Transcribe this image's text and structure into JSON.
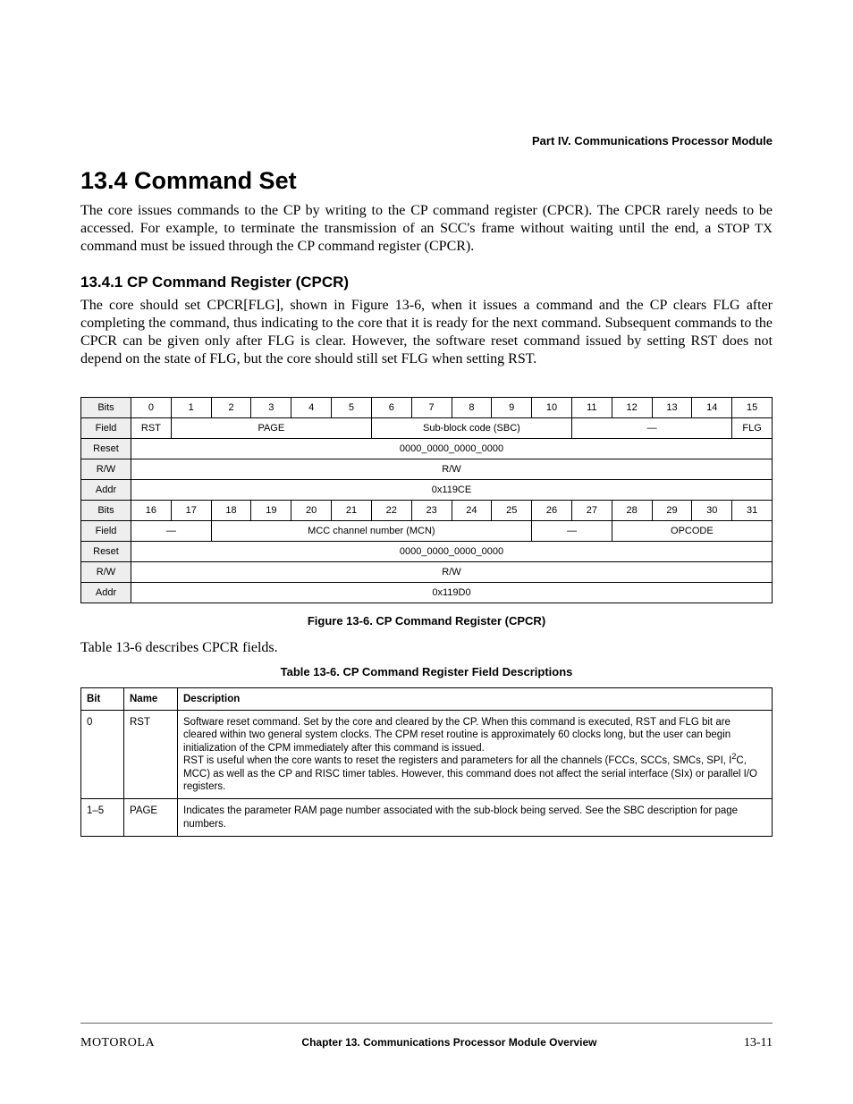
{
  "header": {
    "part": "Part IV.  Communications Processor Module"
  },
  "sections": {
    "s134_title": "13.4  Command Set",
    "s134_para": "The core issues commands to the CP by writing to the CP command register (CPCR). The CPCR rarely needs to be accessed. For example, to terminate the transmission of an SCC's frame without waiting until the end, a ",
    "s134_stop_tx": "STOP TX",
    "s134_para_suffix": " command must be issued through the CP command register (CPCR).",
    "s1341_title": "13.4.1  CP Command Register (CPCR)",
    "s1341_para": "The core should set CPCR[FLG], shown in Figure 13-6, when it issues a command and the CP clears FLG after completing the command, thus indicating to the core that it is ready for the next command. Subsequent commands to the CPCR can be given only after FLG is clear. However, the software reset command issued by setting RST does not depend on the state of FLG, but the core should still set FLG when setting RST."
  },
  "register_table": {
    "row_labels": {
      "bits": "Bits",
      "field": "Field",
      "reset": "Reset",
      "rw": "R/W",
      "addr": "Addr"
    },
    "bits_top": [
      "0",
      "1",
      "2",
      "3",
      "4",
      "5",
      "6",
      "7",
      "8",
      "9",
      "10",
      "11",
      "12",
      "13",
      "14",
      "15"
    ],
    "bits_bot": [
      "16",
      "17",
      "18",
      "19",
      "20",
      "21",
      "22",
      "23",
      "24",
      "25",
      "26",
      "27",
      "28",
      "29",
      "30",
      "31"
    ],
    "top_fields": {
      "rst": "RST",
      "page": "PAGE",
      "sbc": "Sub-block code (SBC)",
      "dash": "—",
      "flg": "FLG"
    },
    "bot_fields": {
      "dash1": "—",
      "mcn": "MCC channel number (MCN)",
      "dash2": "—",
      "opcode": "OPCODE"
    },
    "reset_top": "0000_0000_0000_0000",
    "reset_bot": "0000_0000_0000_0000",
    "rw_top": "R/W",
    "rw_bot": "R/W",
    "addr_top": "0x119CE",
    "addr_bot": "0x119D0"
  },
  "figure_caption": "Figure 13-6. CP Command Register (CPCR)",
  "ref_line": "Table 13-6 describes CPCR fields.",
  "table_caption": "Table 13-6. CP Command Register Field Descriptions",
  "desc_table": {
    "headers": {
      "bit": "Bit",
      "name": "Name",
      "desc": "Description"
    },
    "rows": [
      {
        "bit": "0",
        "name": "RST",
        "desc_line1": "Software reset command. Set by the core and cleared by the CP. When this command is executed, RST and FLG bit are cleared within two general system clocks. The CPM reset routine is approximately 60 clocks long, but the user can begin initialization of the CPM immediately after this command is issued.",
        "desc_line2_pre": "RST is useful when the core wants to reset the registers and parameters for all the channels (FCCs, SCCs, SMCs, SPI, I",
        "desc_line2_sup": "2",
        "desc_line2_post": "C, MCC) as well as the CP and RISC timer tables. However, this command does not affect the serial interface (SIx) or parallel I/O registers."
      },
      {
        "bit": "1–5",
        "name": "PAGE",
        "desc": "Indicates the parameter RAM page number associated with the sub-block being served. See the SBC description for page numbers."
      }
    ]
  },
  "footer": {
    "left": "MOTOROLA",
    "center": "Chapter 13.  Communications Processor Module Overview",
    "right": "13-11"
  }
}
